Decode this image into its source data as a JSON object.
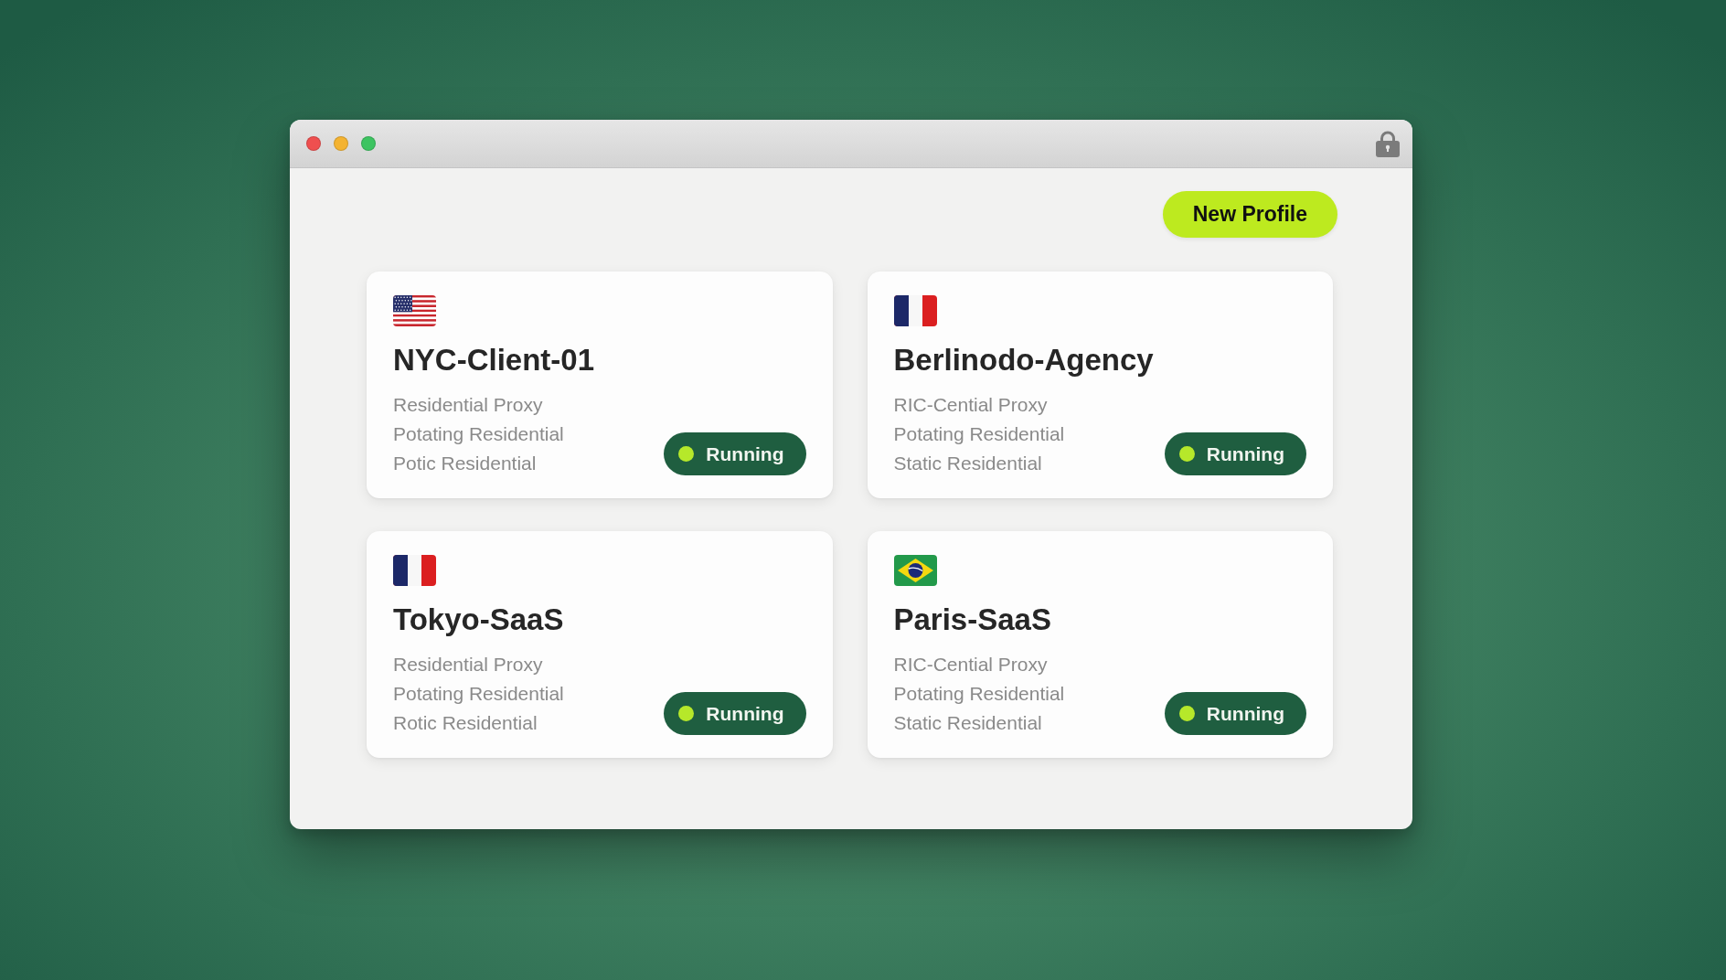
{
  "toolbar": {
    "new_profile_button": "New Profile"
  },
  "profiles": [
    {
      "kind": "us",
      "name": "NYC-Client-01",
      "details": [
        "Residential Proxy",
        "Potating Residential",
        "Potic Residential"
      ],
      "status": "Running"
    },
    {
      "kind": "fr",
      "name": "Berlinodo-Agency",
      "details": [
        "RIC-Cential Proxy",
        "Potating Residential",
        "Static Residential"
      ],
      "status": "Running"
    },
    {
      "kind": "fr",
      "name": "Tokyo-SaaS",
      "details": [
        "Residential Proxy",
        "Potating Residential",
        "Rotic Residential"
      ],
      "status": "Running"
    },
    {
      "kind": "br",
      "name": "Paris-SaaS",
      "details": [
        "RIC-Cential Proxy",
        "Potating Residential",
        "Static Residential"
      ],
      "status": "Running"
    }
  ]
}
